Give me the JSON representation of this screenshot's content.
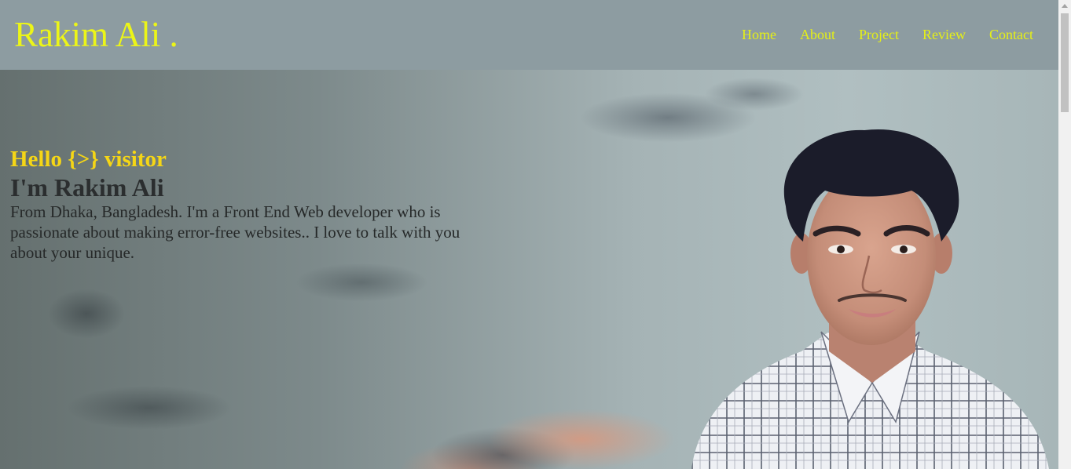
{
  "header": {
    "brand": "Rakim Ali .",
    "nav": [
      "Home",
      "About",
      "Project",
      "Review",
      "Contact"
    ]
  },
  "hero": {
    "greeting": "Hello {>} visitor",
    "name": "I'm Rakim Ali",
    "bio": "From Dhaka, Bangladesh. I'm a Front End Web developer who is passionate about making error-free websites.. I love to talk with you about your unique."
  },
  "colors": {
    "accent": "#ecf518",
    "greeting": "#f5d616",
    "header_bg": "#8d9ca1"
  },
  "icons": [
    "scroll-up-arrow-icon"
  ]
}
